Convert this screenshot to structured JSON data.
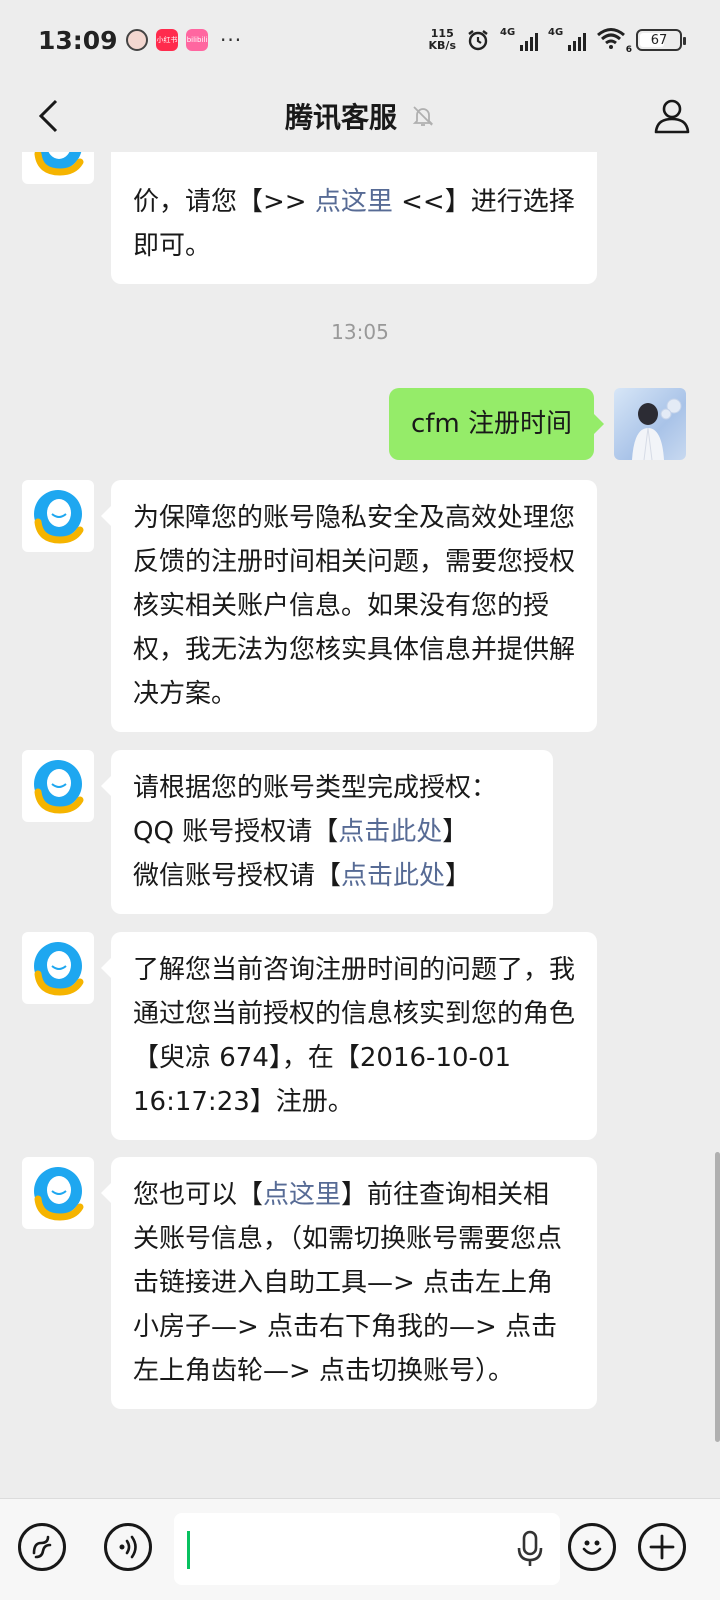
{
  "status_bar": {
    "time": "13:09",
    "app_badge_1": "小红书",
    "app_badge_2": "bilibili",
    "more_dots": "···",
    "net_speed_value": "115",
    "net_speed_unit": "KB/s",
    "signal_1": "4G",
    "signal_2": "4G",
    "wifi_sub": "6",
    "battery": "67",
    "battery_level_percent": 67
  },
  "header": {
    "title": "腾讯客服"
  },
  "messages": {
    "m0": {
      "p1": "价，请您【>> ",
      "link": "点这里",
      "p2": " <<】进行选择即可。"
    },
    "time_sep": "13:05",
    "m1": {
      "text": "cfm 注册时间"
    },
    "m2": {
      "text": "为保障您的账号隐私安全及高效处理您反馈的注册时间相关问题，需要您授权核实相关账户信息。如果没有您的授权，我无法为您核实具体信息并提供解决方案。"
    },
    "m3": {
      "line1": "请根据您的账号类型完成授权：",
      "line2_pre": "QQ 账号授权请【",
      "line2_link": "点击此处",
      "line2_post": "】",
      "line3_pre": "微信账号授权请【",
      "line3_link": "点击此处",
      "line3_post": "】"
    },
    "m4": {
      "text": "了解您当前咨询注册时间的问题了，我通过您当前授权的信息核实到您的角色【臾凉 674】，在【2016-10-01 16:17:23】注册。"
    },
    "m5": {
      "p1": "您也可以【",
      "link": "点这里",
      "p2": "】前往查询相关相关账号信息，（如需切换账号需要您点击链接进入自助工具—> 点击左上角小房子—> 点击右下角我的—> 点击左上角齿轮—> 点击切换账号）。"
    }
  },
  "input_bar": {
    "placeholder": ""
  },
  "colors": {
    "background": "#ededed",
    "bubble_me": "#95ec69",
    "link": "#576b95",
    "cursor": "#07c160"
  }
}
